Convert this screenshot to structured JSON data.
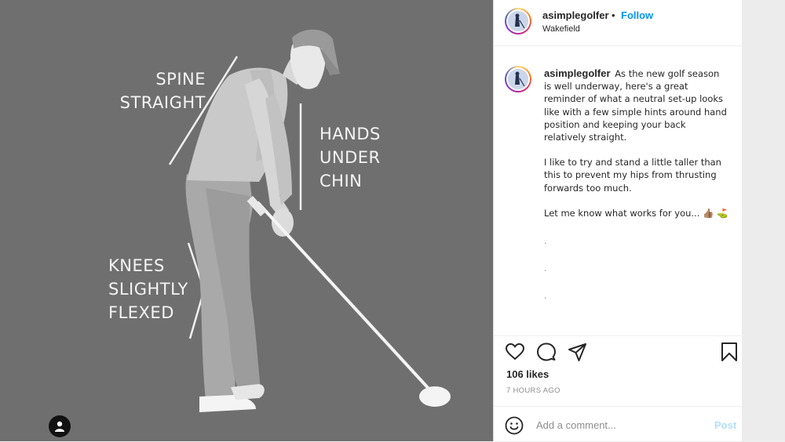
{
  "post_image": {
    "labels": {
      "spine": "SPINE\nSTRAIGHT",
      "hands": "HANDS\nUNDER\nCHIN",
      "knees": "KNEES\nSLIGHTLY\nFLEXED"
    }
  },
  "header": {
    "username": "asimplegolfer",
    "separator": "•",
    "follow_label": "Follow",
    "location": "Wakefield"
  },
  "caption": {
    "username": "asimplegolfer",
    "paragraph1": "As the new golf season is well underway, here's a great reminder of what a neutral set-up looks like with a few simple hints around hand position and keeping your back relatively straight.",
    "paragraph2": "I like to try and stand a little taller than this to prevent my hips from thrusting forwards too much.",
    "paragraph3": "Let me know what works for you... 👍🏽 ⛳",
    "dots": [
      ".",
      ".",
      "."
    ]
  },
  "engagement": {
    "likes": "106 likes",
    "time_ago": "7 HOURS AGO"
  },
  "comment_box": {
    "placeholder": "Add a comment...",
    "post_label": "Post"
  },
  "icons": {
    "like": "heart-icon",
    "comment": "comment-icon",
    "share": "share-icon",
    "save": "bookmark-icon",
    "emoji": "emoji-icon",
    "tagged_user": "user-tag-icon"
  },
  "colors": {
    "accent": "#0095f6",
    "post_disabled": "#b2dffc",
    "image_background": "#6f6f6f"
  }
}
